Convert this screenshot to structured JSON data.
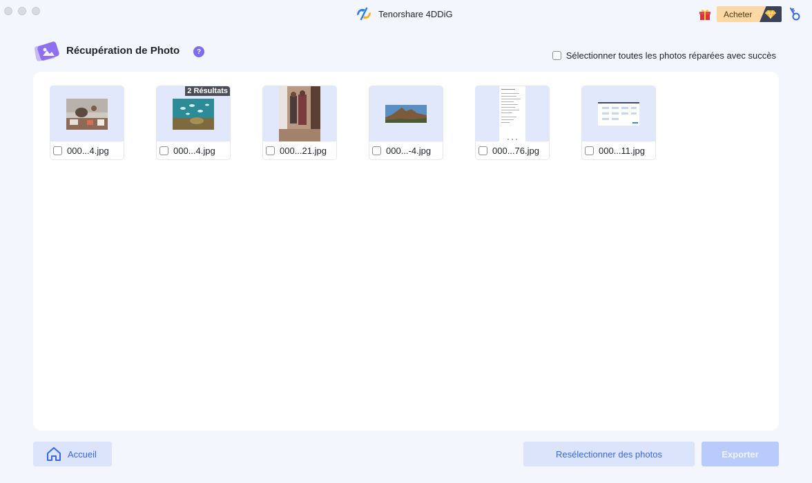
{
  "window": {
    "app_title": "Tenorshare 4DDiG",
    "buy_label": "Acheter"
  },
  "header": {
    "title": "Récupération de Photo",
    "help_glyph": "?",
    "select_all_label": "Sélectionner toutes les photos réparées avec succès"
  },
  "photos": [
    {
      "name": "000...4.jpg",
      "badge": "",
      "thumb_icon": "photo-people-table-thumbnail"
    },
    {
      "name": "000...4.jpg",
      "badge": "2 Résultats",
      "thumb_icon": "photo-underwater-fish-thumbnail"
    },
    {
      "name": "000...21.jpg",
      "badge": "",
      "thumb_icon": "photo-people-room-thumbnail"
    },
    {
      "name": "000...-4.jpg",
      "badge": "",
      "thumb_icon": "photo-rock-landscape-thumbnail"
    },
    {
      "name": "000...76.jpg",
      "badge": "",
      "thumb_icon": "document-screenshot-thumbnail"
    },
    {
      "name": "000...11.jpg",
      "badge": "",
      "thumb_icon": "web-page-screenshot-thumbnail"
    }
  ],
  "footer": {
    "home_label": "Accueil",
    "reselect_label": "Resélectionner des photos",
    "export_label": "Exporter"
  },
  "colors": {
    "accent": "#3767e6",
    "button_bg": "#dbe4fb",
    "export_disabled": "#b8cbfa",
    "buy_bg": "#fcd9a4"
  }
}
